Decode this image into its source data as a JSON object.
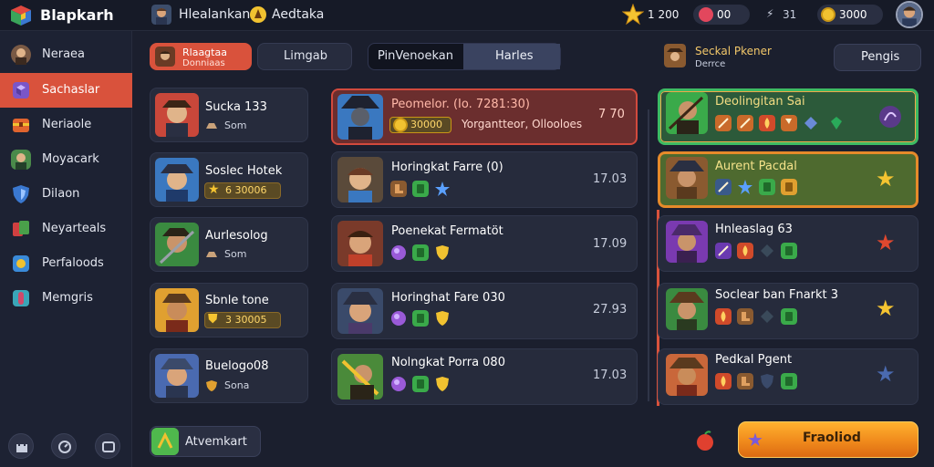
{
  "app": {
    "title": "Blapkarh"
  },
  "topbar": {
    "user1": "Hlealankan",
    "user2": "Aedtaka",
    "stars": "1 200",
    "gems": "00",
    "bolt": "31",
    "coins": "3000"
  },
  "sidebar": {
    "items": [
      {
        "label": "Neraea",
        "color": "#7a5a45"
      },
      {
        "label": "Sachaslar",
        "color": "#7a56c8"
      },
      {
        "label": "Neriaole",
        "color": "#e0642e"
      },
      {
        "label": "Moyacark",
        "color": "#4a8a4a"
      },
      {
        "label": "Dilaon",
        "color": "#3a78d0"
      },
      {
        "label": "Neyarteals",
        "color": "#d04040"
      },
      {
        "label": "Perfaloods",
        "color": "#3a8ad8"
      },
      {
        "label": "Memgris",
        "color": "#3aa6b8"
      }
    ]
  },
  "tabs": {
    "tab_a_title": "Rlaagtaa",
    "tab_a_sub": "Donniaas",
    "tab_b": "Limgab",
    "seg_left": "PinVenoekan",
    "seg_right": "Harles",
    "sort_title": "Seckal Pkener",
    "sort_sub": "Derrce",
    "pengis": "Pengis"
  },
  "left_cards": [
    {
      "name": "Sucka 133",
      "sub": "Som",
      "badge": ""
    },
    {
      "name": "Soslec Hotek",
      "sub": "",
      "badge": "6 30006"
    },
    {
      "name": "Aurlesolog",
      "sub": "Som",
      "badge": ""
    },
    {
      "name": "Sbnle tone",
      "sub": "",
      "badge": "3 30005"
    },
    {
      "name": "Buelogo08",
      "sub": "Sona",
      "badge": ""
    }
  ],
  "middle_cards": [
    {
      "title": "Peomelor. (Io. 7281:30)",
      "coin": "30000",
      "sub": "Yorgantteor, Ollooloes",
      "time": "7 70"
    },
    {
      "title": "Horingkat Farre (0)",
      "time": "17.03"
    },
    {
      "title": "Poenekat Fermatöt",
      "time": "17.09"
    },
    {
      "title": "Horinghat Fare 030",
      "time": "27.93"
    },
    {
      "title": "Nolngkat Porra 080",
      "time": "17.03"
    }
  ],
  "right_cards": [
    {
      "name": "Deolingitan Sai"
    },
    {
      "name": "Aurent Pacdal"
    },
    {
      "name": "Hnleaslag 63"
    },
    {
      "name": "Soclear ban Fnarkt 3"
    },
    {
      "name": "Pedkal Pgent"
    }
  ],
  "bottom": {
    "button": "Atvemkart",
    "cta": "Fraoliod"
  }
}
